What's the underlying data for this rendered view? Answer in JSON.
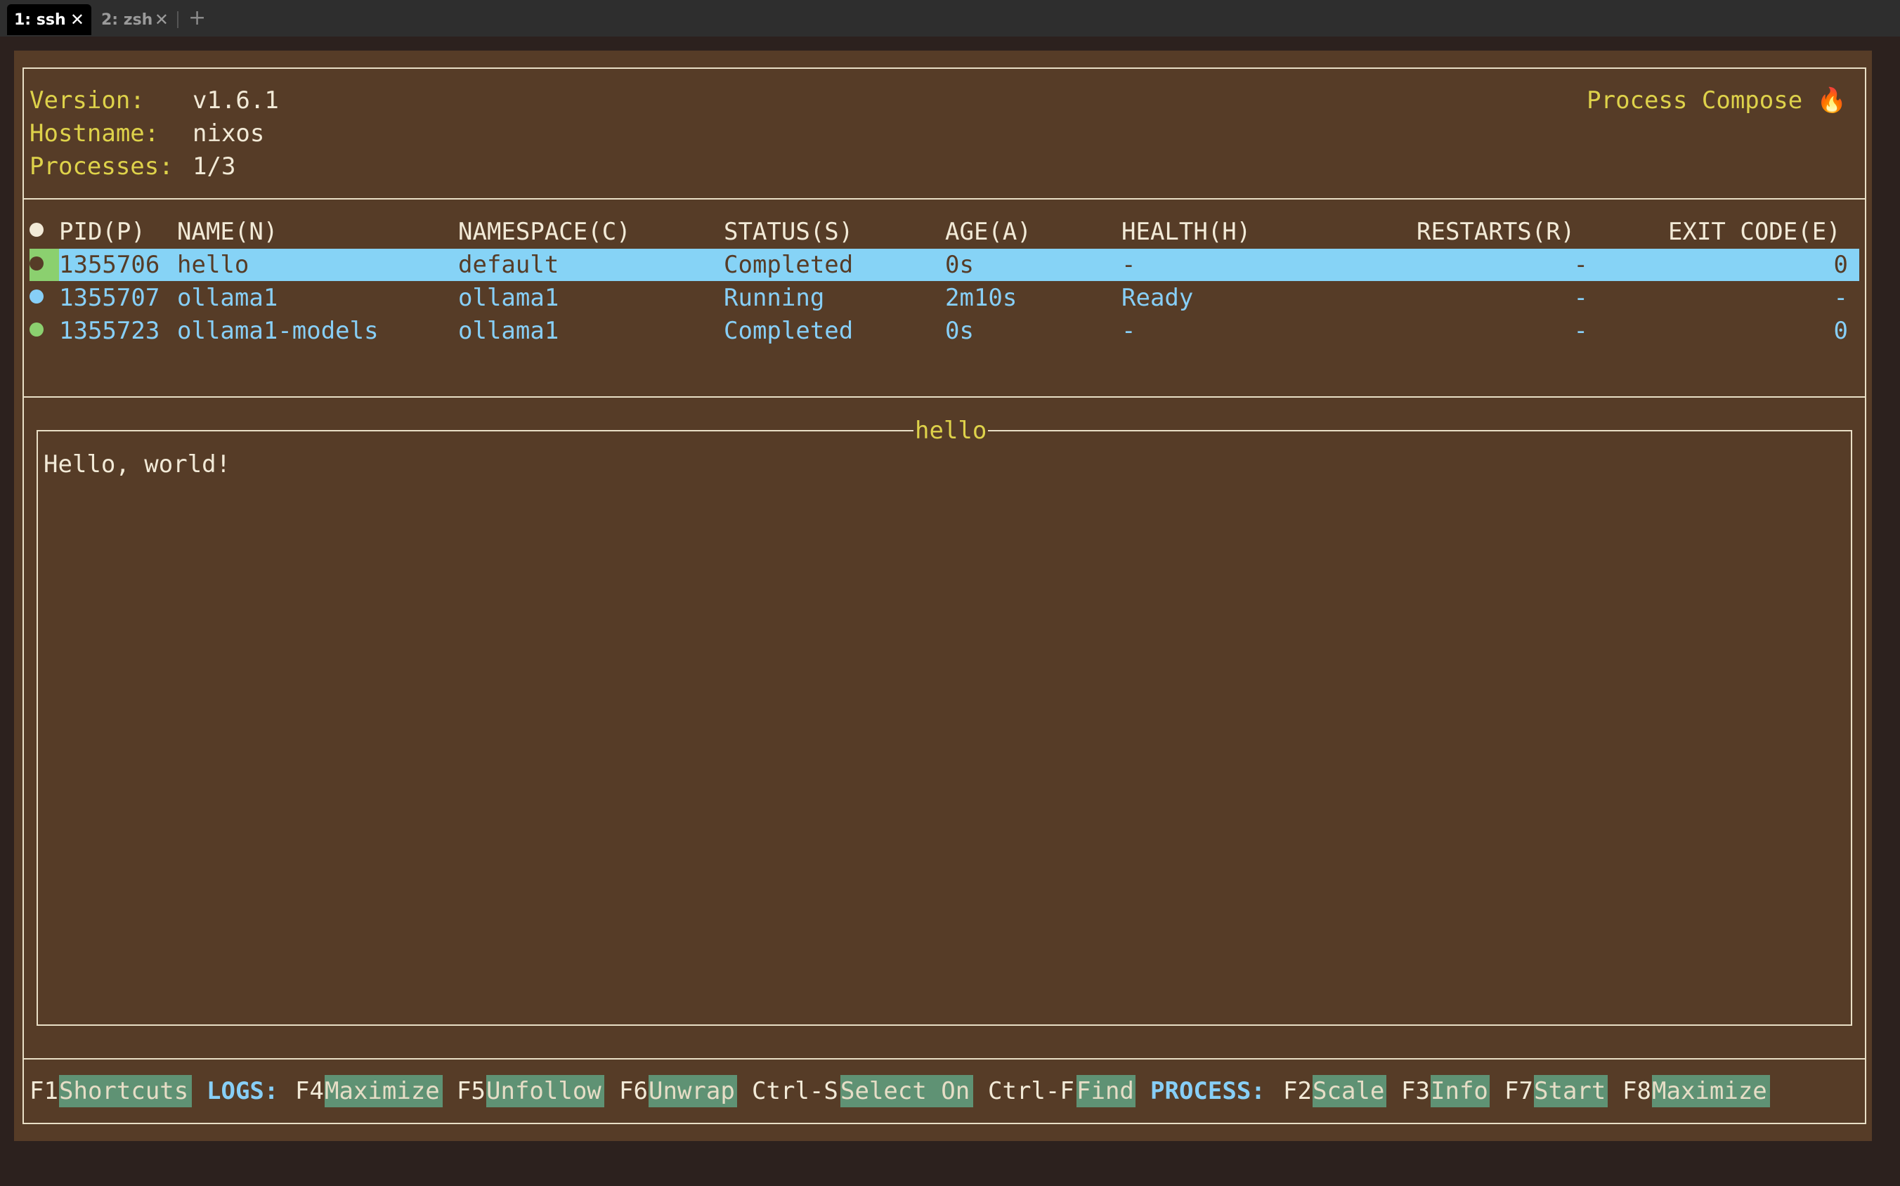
{
  "tabs": [
    {
      "label": "1: ssh",
      "active": true
    },
    {
      "label": "2: zsh",
      "active": false
    }
  ],
  "new_tab_label": "+",
  "close_glyph": "✕",
  "info": {
    "version_label": "Version:",
    "version_value": "v1.6.1",
    "hostname_label": "Hostname:",
    "hostname_value": "nixos",
    "processes_label": "Processes:",
    "processes_value": "1/3",
    "app_title": "Process Compose 🔥"
  },
  "table": {
    "headers": [
      "PID(P)",
      "NAME(N)",
      "NAMESPACE(C)",
      "STATUS(S)",
      "AGE(A)",
      "HEALTH(H)",
      "RESTARTS(R)",
      "EXIT CODE(E)"
    ],
    "rows": [
      {
        "pid": "1355706",
        "name": "hello",
        "namespace": "default",
        "status": "Completed",
        "age": "0s",
        "health": "-",
        "restarts": "-",
        "exit_code": "0",
        "selected": true
      },
      {
        "pid": "1355707",
        "name": "ollama1",
        "namespace": "ollama1",
        "status": "Running",
        "age": "2m10s",
        "health": "Ready",
        "restarts": "-",
        "exit_code": "-",
        "selected": false
      },
      {
        "pid": "1355723",
        "name": "ollama1-models",
        "namespace": "ollama1",
        "status": "Completed",
        "age": "0s",
        "health": "-",
        "restarts": "-",
        "exit_code": "0",
        "selected": false
      }
    ]
  },
  "log_panel": {
    "title": "hello",
    "lines": [
      "Hello, world!"
    ]
  },
  "shortcuts": {
    "f1_key": "F1",
    "f1_label": "Shortcuts",
    "logs_section": "LOGS:",
    "f4_key": "F4",
    "f4_label": "Maximize",
    "f5_key": "F5",
    "f5_label": "Unfollow",
    "f6_key": "F6",
    "f6_label": "Unwrap",
    "ctrls_key": "Ctrl-S",
    "ctrls_label": "Select On",
    "ctrlf_key": "Ctrl-F",
    "ctrlf_label": "Find",
    "process_section": "PROCESS:",
    "f2_key": "F2",
    "f2_label": "Scale",
    "f3_key": "F3",
    "f3_label": "Info",
    "f7_key": "F7",
    "f7_label": "Start",
    "f8_key": "F8",
    "f8_label": "Maximize"
  },
  "colors": {
    "background": "#563c27",
    "accent_yellow": "#ded24a",
    "accent_blue": "#87cff7",
    "selected_row": "#86d3f6",
    "completed_dot": "#8bd06f",
    "running_dot": "#87cff7",
    "key_bg": "#5f9274"
  }
}
